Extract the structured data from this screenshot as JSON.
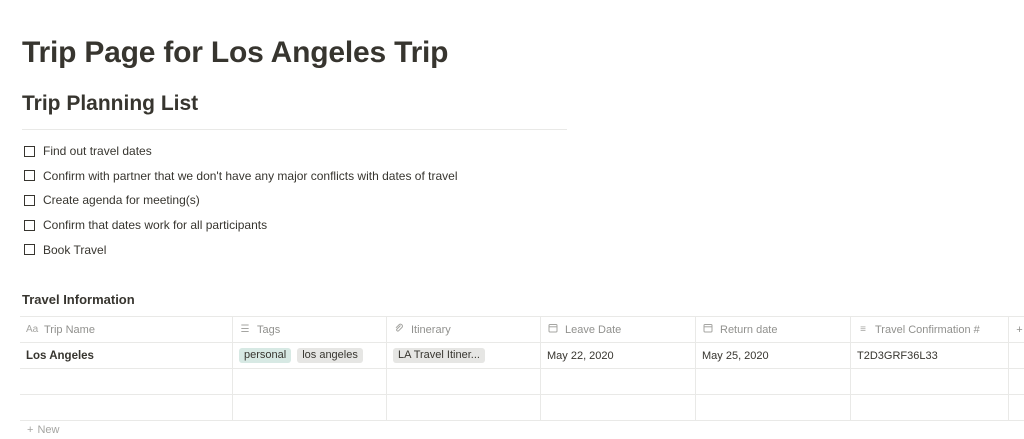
{
  "page": {
    "title": "Trip Page for Los Angeles Trip",
    "section_title": "Trip Planning List"
  },
  "todos": [
    {
      "label": "Find out travel dates",
      "checked": false
    },
    {
      "label": "Confirm with partner that we don't have any major conflicts with dates of travel",
      "checked": false
    },
    {
      "label": "Create agenda for meeting(s)",
      "checked": false
    },
    {
      "label": "Confirm that dates work for all participants",
      "checked": false
    },
    {
      "label": "Book Travel",
      "checked": false
    }
  ],
  "database": {
    "title": "Travel Information",
    "columns": [
      {
        "icon": "Aa",
        "icon_name": "title-property-icon",
        "label": "Trip Name"
      },
      {
        "icon": "☰",
        "icon_name": "multi-select-icon",
        "label": "Tags"
      },
      {
        "icon": "🔗",
        "icon_name": "attachment-icon",
        "label": "Itinerary"
      },
      {
        "icon": "▦",
        "icon_name": "calendar-icon",
        "label": "Leave Date"
      },
      {
        "icon": "▦",
        "icon_name": "calendar-icon",
        "label": "Return date"
      },
      {
        "icon": "≡",
        "icon_name": "text-property-icon",
        "label": "Travel Confirmation #"
      }
    ],
    "add_column": "+",
    "rows": [
      {
        "trip_name": "Los Angeles",
        "tags": [
          "personal",
          "los angeles"
        ],
        "itinerary": "LA Travel Itiner...",
        "leave_date": "May 22, 2020",
        "return_date": "May 25, 2020",
        "confirmation": "T2D3GRF36L33"
      }
    ],
    "new_label": "New",
    "new_plus": "+"
  },
  "colors": {
    "text": "#37352f",
    "muted": "#91918e",
    "border": "#e9e9e7",
    "tag_personal": "#d7e9e4",
    "tag_default": "#e6e6e4"
  }
}
